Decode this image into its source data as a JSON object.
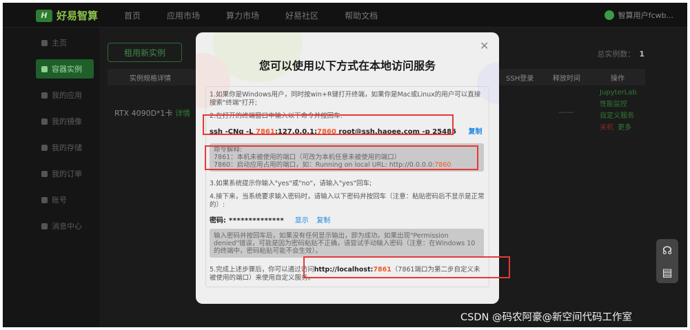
{
  "brand": {
    "name": "好易智算",
    "mark": "H"
  },
  "topnav": [
    "首页",
    "应用市场",
    "算力市场",
    "好易社区",
    "帮助文档"
  ],
  "user": {
    "label": "智算用户fcwb..."
  },
  "sidebar": [
    {
      "label": "主页",
      "active": false
    },
    {
      "label": "容器实例",
      "active": true
    },
    {
      "label": "我的应用",
      "active": false
    },
    {
      "label": "我的镜像",
      "active": false
    },
    {
      "label": "我的存储",
      "active": false
    },
    {
      "label": "我的订单",
      "active": false
    },
    {
      "label": "账号",
      "active": false
    },
    {
      "label": "消息中心",
      "active": false
    }
  ],
  "main": {
    "rent_button": "租用新实例",
    "instance_count_label": "总实例数：",
    "instance_count": "1",
    "table_headers": [
      "实例规格详情",
      "SSH登录",
      "释放时间",
      "操作"
    ],
    "gpu": "RTX 4090D*1卡",
    "gpu_details": "详情",
    "release_time": "——",
    "ops": [
      "JupyterLab",
      "性能监控",
      "自定义服务",
      "关机",
      "更多"
    ]
  },
  "modal": {
    "title": "您可以使用以下方式在本地访问服务",
    "close": "✕",
    "step1": "1.如果你是Windows用户，同时按win+R键打开终端，如果你是Mac或Linux的用户可以直接搜索\"终端\"打开;",
    "step2": "2.在打开的终端窗口中输入以下命令并按回车:",
    "cmd_prefix": "ssh -CNg -L ",
    "cmd_port1": "7861",
    "cmd_mid": ":127.0.0.1:",
    "cmd_port2": "7860",
    "cmd_suffix": " root@ssh.haoee.com -p 25485",
    "copy": "复制",
    "explain_title": "命令解释:",
    "explain_line1": "7861：本机未被使用的端口（可改为本机任意未被使用的端口）",
    "explain_line2_prefix": "7860：启动应用占用的端口，如：Running on local URL: http://0.0.0.0:",
    "explain_line2_port": "7860",
    "step3": "3.如果系统提示你输入\"yes\"或\"no\"，请输入\"yes\"回车;",
    "step4": "4.接下来，当系统要求输入密码时，请输入以下密码并按回车（注意：粘贴密码后不显示是正常的）:",
    "password_label": "密码:",
    "password_mask": "**************",
    "show": "显示",
    "note": "输入密码并按回车后，如果没有任何显示输出，即为成功。如果出现\"Permission denied\"错误，可能是因为密码粘贴不正确，请尝试手动输入密码（注意：在Windows 10的终端中，密码粘贴可能不会生效）。",
    "step5_prefix": "5.完成上述步骤后，你可以通过访问",
    "step5_url": "http://localhost:",
    "step5_port": "7861",
    "step5_suffix": "（7861端口为第二步自定义未被使用的端口）来使用自定义服务。"
  },
  "watermark": "CSDN @码农阿豪@新空间代码工作室",
  "colors": {
    "accent_red": "#ef5a2f",
    "link_blue": "#1e88e5",
    "highlight": "#e53935"
  }
}
